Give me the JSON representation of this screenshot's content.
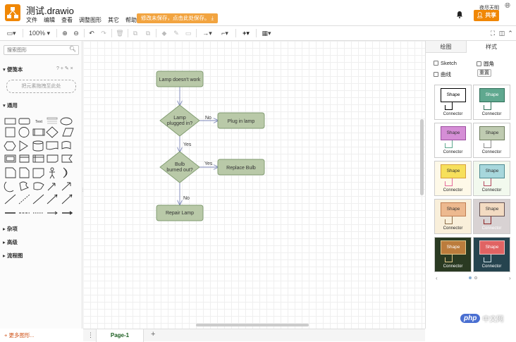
{
  "app": {
    "doc_title": "测试.drawio",
    "menu": [
      "文件",
      "编辑",
      "查看",
      "调整图形",
      "其它",
      "帮助"
    ],
    "unsaved_notice": "修改未保存，点击此处保存。",
    "user_name": "夜尽天明",
    "share_label": "共享",
    "brand_color": "#f08705"
  },
  "toolbar": {
    "zoom": "100%"
  },
  "left_panel": {
    "search_placeholder": "搜索图形",
    "scratchpad_title": "便笺本",
    "scratchpad_controls": "? + ✎ ×",
    "drop_hint": "把元素拖拽至此处",
    "general_title": "通用",
    "text_label": "Text",
    "sections": [
      "杂项",
      "高级",
      "流程图"
    ],
    "more_shapes": "+ 更多图形..."
  },
  "diagram": {
    "nodes": {
      "start": "Lamp doesn't work",
      "q1_line1": "Lamp",
      "q1_line2": "plugged in?",
      "plug": "Plug in lamp",
      "q2_line1": "Bulb",
      "q2_line2": "burned out?",
      "replace": "Replace Bulb",
      "repair": "Repair Lamp"
    },
    "edges": {
      "q1_no": "No",
      "q1_yes": "Yes",
      "q2_yes": "Yes",
      "q2_no": "No"
    },
    "node_fill": "#b9c9a8",
    "node_stroke": "#7f9a6f",
    "edge_color": "#7b86b8"
  },
  "pages": {
    "current": "Page-1",
    "add_icon": "+"
  },
  "right_panel": {
    "tabs": [
      "绘图",
      "样式"
    ],
    "options": {
      "sketch": "Sketch",
      "rounded": "圆角",
      "curved": "曲线",
      "reset": "重置"
    },
    "style_shape_label": "Shape",
    "style_connector_label": "Connector",
    "styles": [
      {
        "fill": "#ffffff",
        "stroke": "#000000",
        "bg": "#ffffff",
        "text": "#000000",
        "conn": "#000000"
      },
      {
        "fill": "#5fa88f",
        "stroke": "#2f6e58",
        "bg": "#ffffff",
        "text": "#ffffff",
        "conn": "#2f6e58"
      },
      {
        "fill": "#d58ed6",
        "stroke": "#9c4ea0",
        "bg": "#ffffff",
        "text": "#333333",
        "conn": "#5fa88f"
      },
      {
        "fill": "#bfcbb1",
        "stroke": "#6e7d5e",
        "bg": "#ffffff",
        "text": "#333333",
        "conn": "#8b8b8b"
      },
      {
        "fill": "#f7e05b",
        "stroke": "#d8a13d",
        "bg": "#fef9e8",
        "text": "#333333",
        "conn": "#e56b9d"
      },
      {
        "fill": "#a7d7dc",
        "stroke": "#4f8b92",
        "bg": "#f2f9ee",
        "text": "#333333",
        "conn": "#b3475e"
      },
      {
        "fill": "#edb98f",
        "stroke": "#bf7d52",
        "bg": "#f9efda",
        "text": "#333333",
        "conn": "#8b6d4a"
      },
      {
        "fill": "#f3dbc2",
        "stroke": "#665252",
        "bg": "#d8d2d3",
        "text": "#333333",
        "conn": "#8a1f1f"
      },
      {
        "fill": "#bb7c3c",
        "stroke": "#e3c98d",
        "bg": "#2a3a22",
        "text": "#ffffff",
        "conn": "#e3c98d"
      },
      {
        "fill": "#e06363",
        "stroke": "#efc0c0",
        "bg": "#26444f",
        "text": "#ffffff",
        "conn": "#cfe4ea"
      }
    ]
  }
}
